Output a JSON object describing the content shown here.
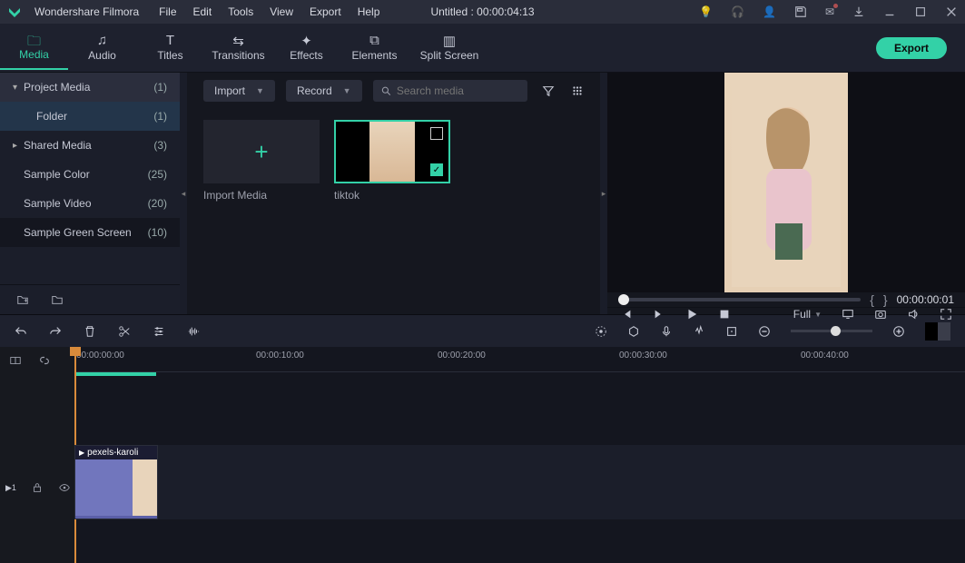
{
  "app": {
    "name": "Wondershare Filmora",
    "doc_title": "Untitled : 00:00:04:13"
  },
  "menu": {
    "file": "File",
    "edit": "Edit",
    "tools": "Tools",
    "view": "View",
    "export": "Export",
    "help": "Help"
  },
  "tabs": {
    "media": "Media",
    "audio": "Audio",
    "titles": "Titles",
    "transitions": "Transitions",
    "effects": "Effects",
    "elements": "Elements",
    "split": "Split Screen",
    "export": "Export"
  },
  "sidebar": {
    "project": {
      "label": "Project Media",
      "count": "(1)"
    },
    "folder": {
      "label": "Folder",
      "count": "(1)"
    },
    "shared": {
      "label": "Shared Media",
      "count": "(3)"
    },
    "color": {
      "label": "Sample Color",
      "count": "(25)"
    },
    "video": {
      "label": "Sample Video",
      "count": "(20)"
    },
    "green": {
      "label": "Sample Green Screen",
      "count": "(10)"
    }
  },
  "media": {
    "import": "Import",
    "record": "Record",
    "search_ph": "Search media",
    "tile_import": "Import Media",
    "tile_tiktok": "tiktok"
  },
  "preview": {
    "timecode": "00:00:00:01",
    "full": "Full"
  },
  "ruler": [
    "00:00:00:00",
    "00:00:10:00",
    "00:00:20:00",
    "00:00:30:00",
    "00:00:40:00"
  ],
  "clip": {
    "name": "pexels-karoli"
  },
  "track": {
    "id": "1"
  }
}
